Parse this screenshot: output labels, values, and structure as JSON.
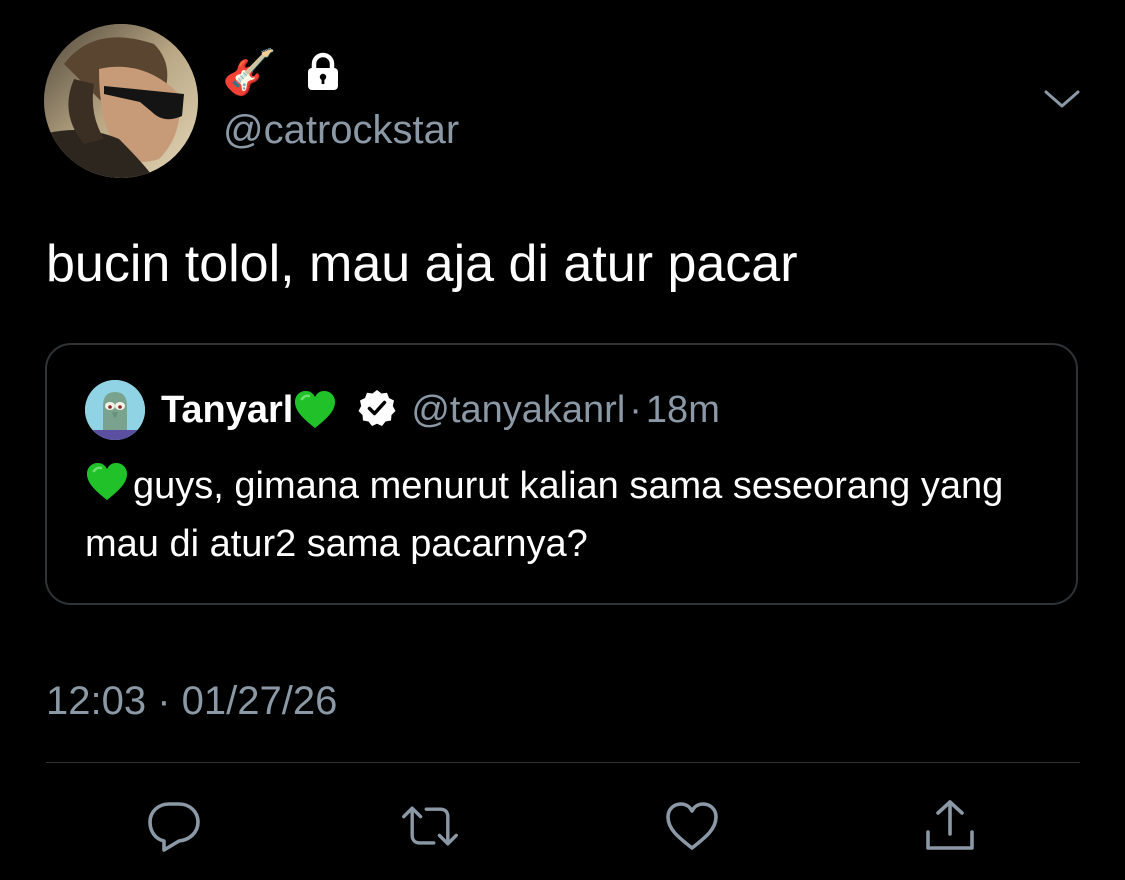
{
  "author": {
    "display_name_emoji": "🎸",
    "handle": "@catrockstar",
    "protected_icon": "lock-icon",
    "avatar_icon": "profile-photo"
  },
  "tweet": {
    "text": "bucin tolol, mau aja di atur pacar",
    "timestamp": "12:03 · 01/27/26"
  },
  "quoted_tweet": {
    "name": "Tanyarl",
    "name_emoji": "green-heart-icon",
    "verified_icon": "verified-badge-icon",
    "handle": "@tanyakanrl",
    "separator": "·",
    "time": "18m",
    "text_emoji": "green-heart-icon",
    "text": "guys, gimana menurut kalian sama seseorang yang mau di atur2 sama pacarnya?"
  },
  "actions": [
    {
      "icon": "reply-icon"
    },
    {
      "icon": "retweet-icon"
    },
    {
      "icon": "like-icon"
    },
    {
      "icon": "share-icon"
    }
  ],
  "colors": {
    "background": "#000000",
    "primary_text": "#ffffff",
    "secondary_text": "#8b98a5",
    "border": "#2f3336",
    "heart_green": "#21c12a"
  }
}
